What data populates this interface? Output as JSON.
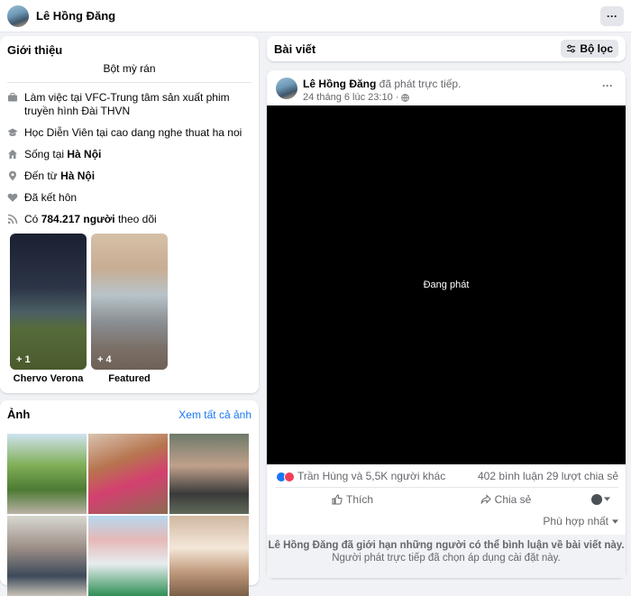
{
  "header": {
    "name": "Lê Hồng Đăng",
    "more_label": "···"
  },
  "intro": {
    "title": "Giới thiệu",
    "bio": "Bột mỳ rán",
    "work": "Làm việc tại VFC-Trung tâm sản xuất phim truyền hình Đài THVN",
    "study": "Học Diễn Viên tại cao dang nghe thuat ha noi",
    "lives_prefix": "Sống tại ",
    "lives_city": "Hà Nội",
    "from_prefix": "Đến từ ",
    "from_city": "Hà Nội",
    "relationship": "Đã kết hôn",
    "followers_prefix": "Có ",
    "followers_count": "784.217 người",
    "followers_suffix": " theo dõi",
    "featured": [
      {
        "count": "+ 1",
        "caption": "Chervo Verona"
      },
      {
        "count": "+ 4",
        "caption": "Featured"
      }
    ]
  },
  "photos": {
    "title": "Ảnh",
    "see_all": "Xem tất cả ảnh"
  },
  "posts": {
    "title": "Bài viết",
    "filter_label": "Bộ lọc"
  },
  "post": {
    "author": "Lê Hồng Đăng",
    "action": " đã phát trực tiếp.",
    "time": "24 tháng 6 lúc 23:10 ·",
    "more_label": "···",
    "video_label": "Đang phát",
    "reactions_text": "Trần Hùng và 5,5K người khác",
    "comments": "402 bình luận",
    "shares": "29 lượt chia sẻ",
    "like_label": "Thích",
    "share_label": "Chia sẻ",
    "sort_label": "Phù hợp nhất",
    "notice_line1": "Lê Hồng Đăng đã giới hạn những người có thể bình luận về bài viết này.",
    "notice_line2": "Người phát trực tiếp đã chọn áp dụng cài đặt này."
  },
  "colors": {
    "link": "#1877f2",
    "like": "#1877f2",
    "love": "#f33e58"
  }
}
